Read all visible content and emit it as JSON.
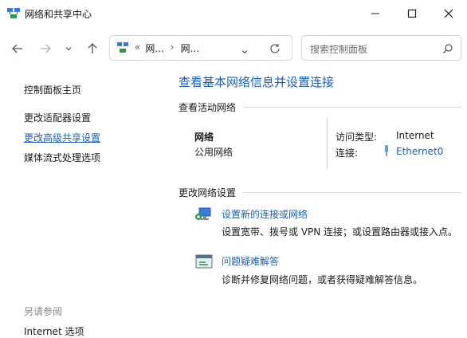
{
  "window": {
    "title": "网络和共享中心",
    "controls": {
      "minimize": "minimize",
      "maximize": "maximize",
      "close": "close"
    }
  },
  "nav": {
    "address_prefix": "«",
    "crumb1": "网...",
    "crumb_sep": "›",
    "crumb2": "网...",
    "search_placeholder": "搜索控制面板"
  },
  "sidebar": {
    "items": [
      {
        "label": "控制面板主页"
      },
      {
        "label": "更改适配器设置"
      },
      {
        "label": "更改高级共享设置"
      },
      {
        "label": "媒体流式处理选项"
      }
    ],
    "see_also_title": "另请参阅",
    "see_also_items": [
      {
        "label": "Internet 选项"
      }
    ]
  },
  "main": {
    "heading": "查看基本网络信息并设置连接",
    "active_section_title": "查看活动网络",
    "network": {
      "name": "网络",
      "type": "公用网络",
      "access_label": "访问类型:",
      "access_value": "Internet",
      "connections_label": "连接:",
      "connections_value": "Ethernet0"
    },
    "change_section_title": "更改网络设置",
    "tasks": [
      {
        "link": "设置新的连接或网络",
        "desc": "设置宽带、拨号或 VPN 连接；或设置路由器或接入点。",
        "icon": "network-setup-icon"
      },
      {
        "link": "问题疑难解答",
        "desc": "诊断并修复网络问题，或者获得疑难解答信息。",
        "icon": "troubleshoot-icon"
      }
    ]
  },
  "colors": {
    "accent": "#1a5fb4",
    "text": "#1a1a1a",
    "muted": "#8a8a8a"
  }
}
